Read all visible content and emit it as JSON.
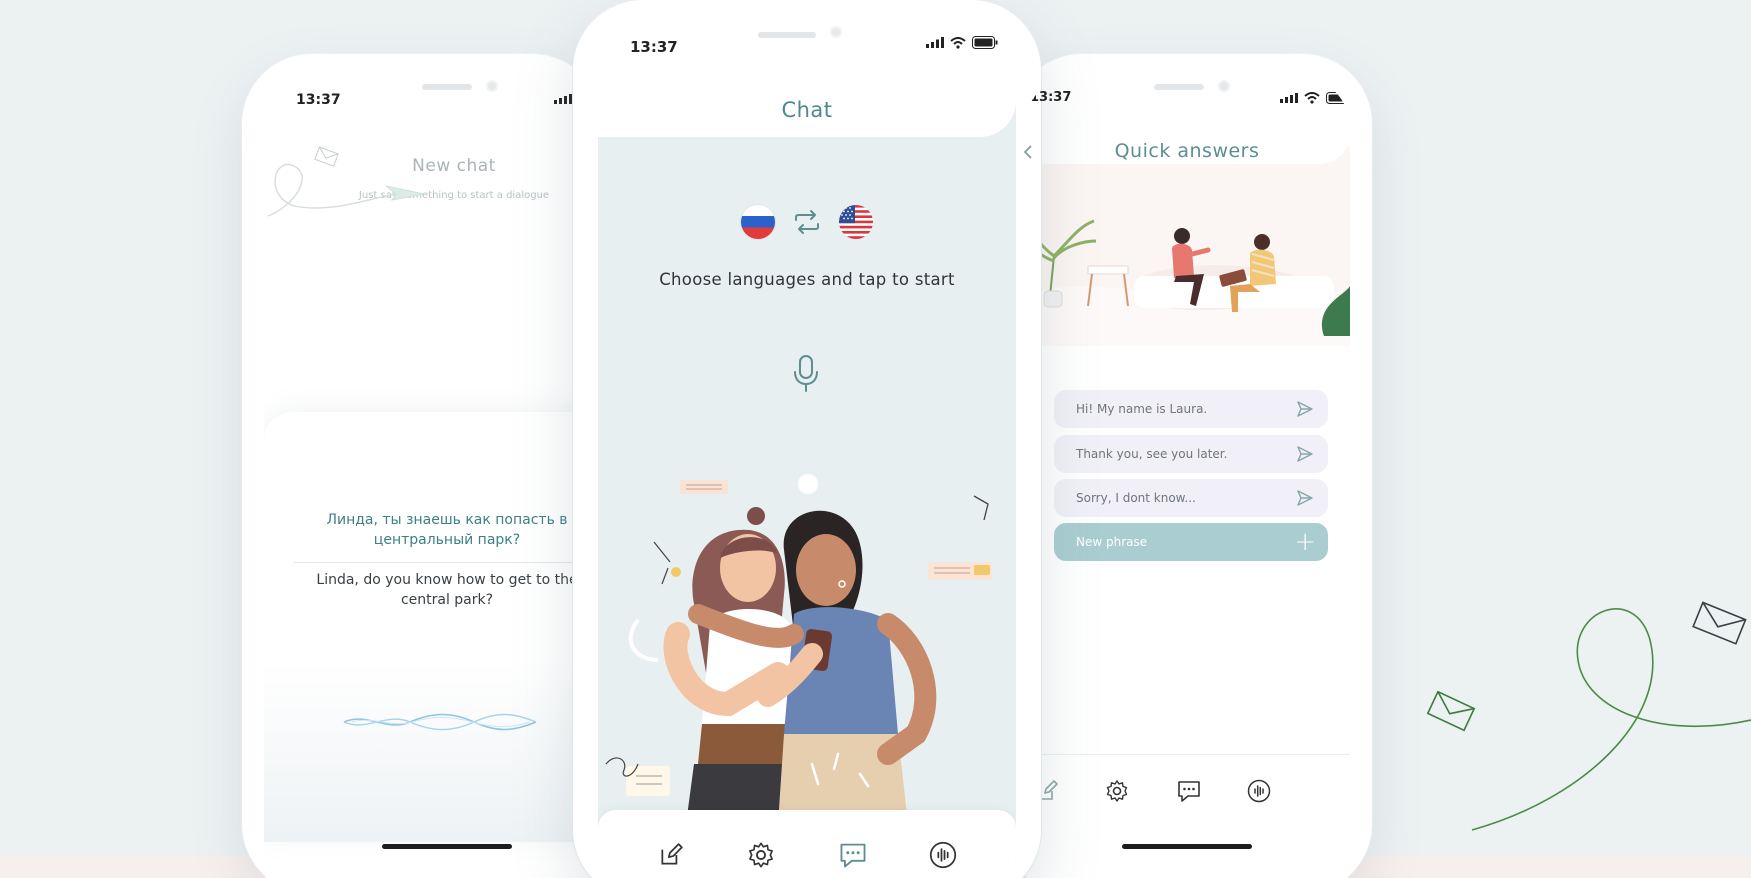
{
  "left_phone": {
    "time": "13:37",
    "title": "New chat",
    "subtitle": "Just say something to start a dialogue",
    "russian_message": "Линда, ты знаешь как попасть в центральный парк?",
    "english_message": "Linda, do you know how to get to the central park?"
  },
  "center_phone": {
    "time": "13:37",
    "title": "Chat",
    "source_language_flag": "russia-flag",
    "target_language_flag": "usa-flag",
    "instruction": "Choose languages and tap to start",
    "tabs": [
      "edit-icon",
      "settings-icon",
      "chat-icon",
      "voice-icon"
    ]
  },
  "right_phone": {
    "time": "13:37",
    "title": "Quick answers",
    "phrases": [
      "Hi! My name is Laura.",
      "Thank you, see you later.",
      "Sorry, I dont know..."
    ],
    "new_phrase_label": "New phrase",
    "tabs": [
      "edit-icon",
      "settings-icon",
      "chat-icon",
      "voice-icon"
    ]
  },
  "colors": {
    "background": "#ecf1f2",
    "accent_teal": "#4c8a8f",
    "new_phrase_button": "#a9cdd1",
    "phrase_bg": "#f1f0f8",
    "deco_green": "#3f7a3f"
  }
}
